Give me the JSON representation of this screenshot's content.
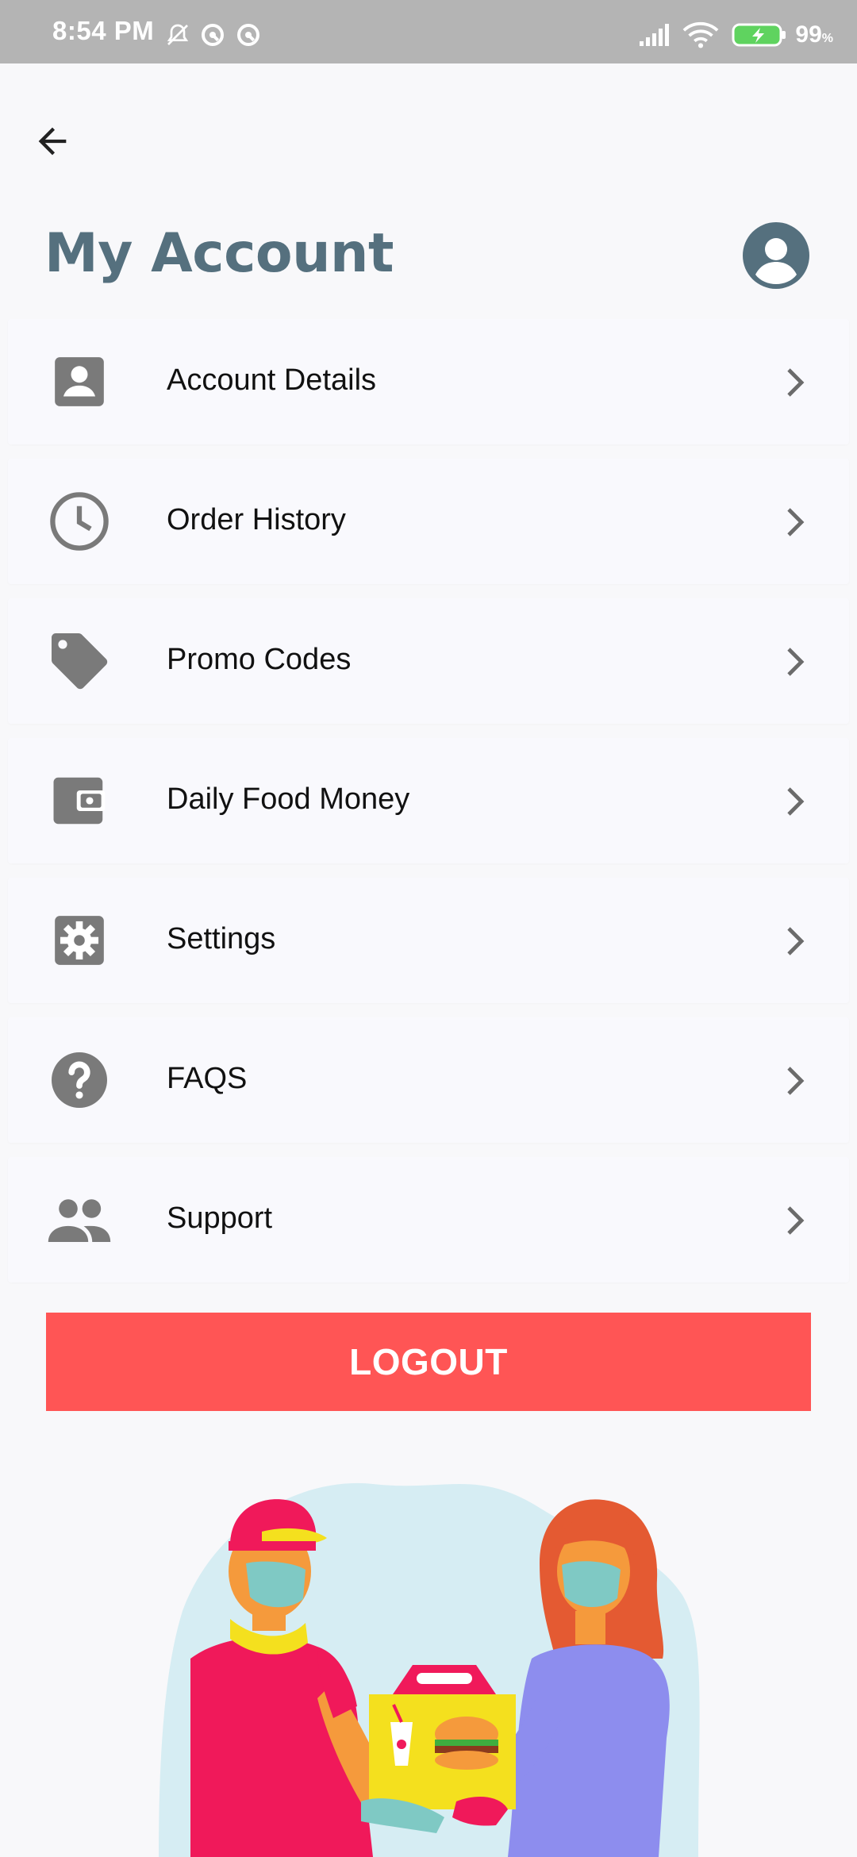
{
  "status_bar": {
    "time": "8:54 PM",
    "battery_percent": "99",
    "battery_unit": "%",
    "icons": [
      "mute-notification-icon",
      "app-notification-icon",
      "app-notification-icon",
      "signal-icon",
      "wifi-icon",
      "battery-charging-icon"
    ]
  },
  "header": {
    "back_icon": "arrow-left-icon",
    "title": "My Account",
    "avatar_icon": "person-circle-icon"
  },
  "menu": {
    "items": [
      {
        "label": "Account Details",
        "icon": "contact-card-icon"
      },
      {
        "label": "Order History",
        "icon": "clock-icon"
      },
      {
        "label": "Promo Codes",
        "icon": "tag-icon"
      },
      {
        "label": "Daily Food Money",
        "icon": "wallet-icon"
      },
      {
        "label": "Settings",
        "icon": "gear-icon"
      },
      {
        "label": "FAQS",
        "icon": "help-circle-icon"
      },
      {
        "label": "Support",
        "icon": "people-icon"
      }
    ]
  },
  "logout": {
    "label": "LOGOUT"
  },
  "colors": {
    "accent": "#55707e",
    "logout": "#ff5555",
    "icon_gray": "#7a7a7a",
    "background": "#f8f8fa"
  }
}
